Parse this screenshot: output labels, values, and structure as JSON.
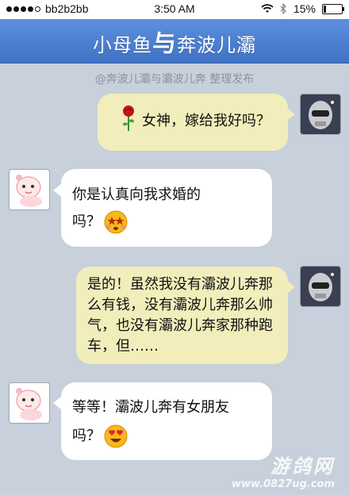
{
  "status_bar": {
    "carrier": "bb2b2bb",
    "time": "3:50 AM",
    "battery": "15%",
    "battery_level": 0.15,
    "signal_bars_filled": 4
  },
  "header": {
    "title_part1": "小母鱼",
    "title_connector": "与",
    "title_part2": "奔波儿灞"
  },
  "credit": "@奔波儿灞与灞波儿奔 整理发布",
  "messages": [
    {
      "side": "right",
      "text": "女神，嫁给我好吗？",
      "icon": "rose-icon"
    },
    {
      "side": "left",
      "line1": "你是认真向我求婚的",
      "line2": "吗？",
      "icon": "starry-eyed-emoji-icon"
    },
    {
      "side": "right",
      "text": "是的！虽然我没有灞波儿奔那么有钱，没有灞波儿奔那么帅气，也没有灞波儿奔家那种跑车，但……"
    },
    {
      "side": "left",
      "line1": "等等！灞波儿奔有女朋友",
      "line2": "吗？",
      "icon": "heart-eyes-emoji-icon"
    }
  ],
  "watermark": {
    "title": "游鸽网",
    "url": "www.0827ug.com"
  },
  "colors": {
    "background": "#c7d0db",
    "header": "#4a7fd2",
    "bubble_right": "#f1eebb",
    "bubble_left": "#ffffff"
  }
}
